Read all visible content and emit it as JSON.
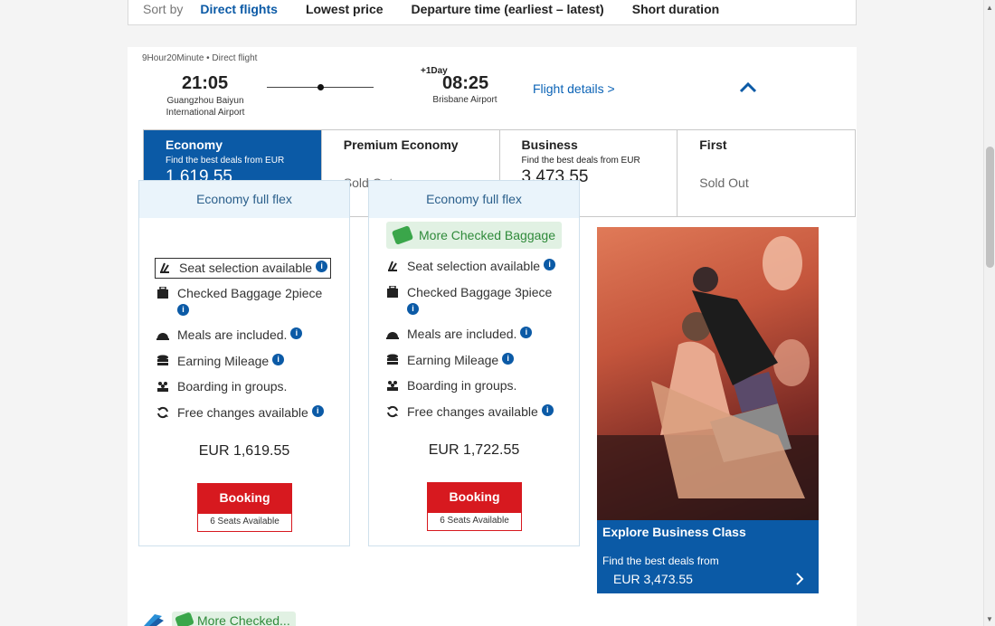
{
  "sort": {
    "label": "Sort by",
    "options": [
      "Direct flights",
      "Lowest price",
      "Departure time (earliest – latest)",
      "Short duration"
    ],
    "active": "Direct flights"
  },
  "flight": {
    "duration": "9Hour20Minute • Direct flight",
    "departure": {
      "time": "21:05",
      "airport": "Guangzhou Baiyun International Airport"
    },
    "arrival": {
      "time": "08:25",
      "day_offset": "+1Day",
      "airport": "Brisbane Airport"
    },
    "details_link": "Flight details >"
  },
  "cabins": [
    {
      "name": "Economy",
      "note": "Find the best deals from EUR",
      "price": "1,619.55",
      "status": ""
    },
    {
      "name": "Premium Economy",
      "note": "",
      "price": "",
      "status": "Sold Out"
    },
    {
      "name": "Business",
      "note": "Find the best deals from EUR",
      "price": "3,473.55",
      "status": ""
    },
    {
      "name": "First",
      "note": "",
      "price": "",
      "status": "Sold Out"
    }
  ],
  "fares": [
    {
      "title": "Economy full flex",
      "badge": "",
      "features": {
        "seat": "Seat selection available",
        "baggage": "Checked Baggage 2piece",
        "meals": "Meals are included.",
        "mileage": "Earning Mileage",
        "boarding": "Boarding in groups.",
        "changes": "Free changes available"
      },
      "price": "EUR 1,619.55",
      "button": "Booking",
      "seats": "6 Seats Available"
    },
    {
      "title": "Economy full flex",
      "badge": "More Checked Baggage",
      "features": {
        "seat": "Seat selection available",
        "baggage": "Checked Baggage 3piece",
        "meals": "Meals are included.",
        "mileage": "Earning Mileage",
        "boarding": "Boarding in groups.",
        "changes": "Free changes available"
      },
      "price": "EUR 1,722.55",
      "button": "Booking",
      "seats": "6 Seats Available"
    }
  ],
  "promo": {
    "title": "Explore Business Class",
    "note": "Find the best deals from",
    "price": "EUR 3,473.55"
  },
  "next_badge": "More Checked...",
  "colors": {
    "brand_blue": "#0b5aa6",
    "booking_red": "#d7191f",
    "badge_green": "#2f8a3a"
  }
}
